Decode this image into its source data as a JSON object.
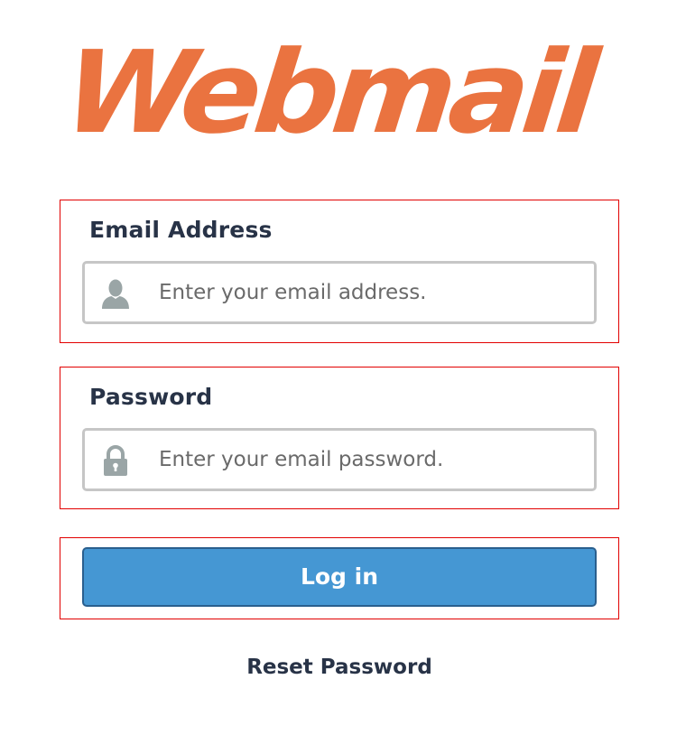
{
  "brand": {
    "logo_text": "Webmail",
    "accent_color": "#ea7340"
  },
  "login_form": {
    "email": {
      "label": "Email Address",
      "placeholder": "Enter your email address.",
      "value": "",
      "icon": "user-icon"
    },
    "password": {
      "label": "Password",
      "placeholder": "Enter your email password.",
      "value": "",
      "icon": "lock-icon"
    },
    "submit_label": "Log in",
    "reset_label": "Reset Password",
    "button_color": "#4597d3",
    "highlight_color": "#e20000"
  }
}
